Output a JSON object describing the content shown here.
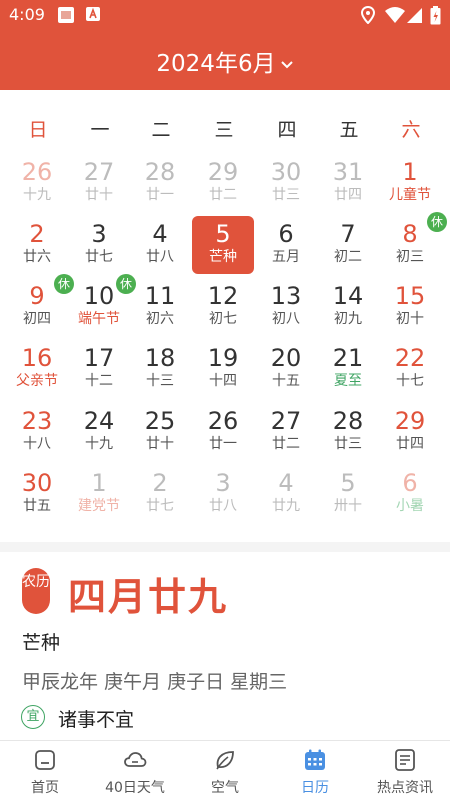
{
  "status_bar": {
    "time": "4:09"
  },
  "header": {
    "month_title": "2024年6月"
  },
  "weekdays": [
    "日",
    "一",
    "二",
    "三",
    "四",
    "五",
    "六"
  ],
  "calendar": {
    "days": [
      {
        "day": "26",
        "sub": "十九",
        "other": true
      },
      {
        "day": "27",
        "sub": "廿十",
        "other": true
      },
      {
        "day": "28",
        "sub": "廿一",
        "other": true
      },
      {
        "day": "29",
        "sub": "廿二",
        "other": true
      },
      {
        "day": "30",
        "sub": "廿三",
        "other": true
      },
      {
        "day": "31",
        "sub": "廿四",
        "other": true
      },
      {
        "day": "1",
        "sub": "儿童节",
        "sub_type": "festival"
      },
      {
        "day": "2",
        "sub": "廿六"
      },
      {
        "day": "3",
        "sub": "廿七"
      },
      {
        "day": "4",
        "sub": "廿八"
      },
      {
        "day": "5",
        "sub": "芒种",
        "today": true
      },
      {
        "day": "6",
        "sub": "五月"
      },
      {
        "day": "7",
        "sub": "初二"
      },
      {
        "day": "8",
        "sub": "初三",
        "badge": "休"
      },
      {
        "day": "9",
        "sub": "初四",
        "badge": "休"
      },
      {
        "day": "10",
        "sub": "端午节",
        "sub_type": "festival",
        "badge": "休"
      },
      {
        "day": "11",
        "sub": "初六"
      },
      {
        "day": "12",
        "sub": "初七"
      },
      {
        "day": "13",
        "sub": "初八"
      },
      {
        "day": "14",
        "sub": "初九"
      },
      {
        "day": "15",
        "sub": "初十"
      },
      {
        "day": "16",
        "sub": "父亲节",
        "sub_type": "festival"
      },
      {
        "day": "17",
        "sub": "十二"
      },
      {
        "day": "18",
        "sub": "十三"
      },
      {
        "day": "19",
        "sub": "十四"
      },
      {
        "day": "20",
        "sub": "十五"
      },
      {
        "day": "21",
        "sub": "夏至",
        "sub_type": "term"
      },
      {
        "day": "22",
        "sub": "十七"
      },
      {
        "day": "23",
        "sub": "十八"
      },
      {
        "day": "24",
        "sub": "十九"
      },
      {
        "day": "25",
        "sub": "廿十"
      },
      {
        "day": "26",
        "sub": "廿一"
      },
      {
        "day": "27",
        "sub": "廿二"
      },
      {
        "day": "28",
        "sub": "廿三"
      },
      {
        "day": "29",
        "sub": "廿四"
      },
      {
        "day": "30",
        "sub": "廿五"
      },
      {
        "day": "1",
        "sub": "建党节",
        "sub_type": "festival",
        "other": true
      },
      {
        "day": "2",
        "sub": "廿七",
        "other": true
      },
      {
        "day": "3",
        "sub": "廿八",
        "other": true
      },
      {
        "day": "4",
        "sub": "廿九",
        "other": true
      },
      {
        "day": "5",
        "sub": "卅十",
        "other": true
      },
      {
        "day": "6",
        "sub": "小暑",
        "sub_type": "term",
        "other": true
      }
    ]
  },
  "info": {
    "lunar_badge": "农历",
    "lunar_date": "四月廿九",
    "solar_term": "芒种",
    "ganzhi": "甲辰龙年 庚午月 庚子日 星期三",
    "yi_badge": "宜",
    "yi_text": "诸事不宜"
  },
  "nav": [
    {
      "label": "首页",
      "icon": "home-icon"
    },
    {
      "label": "40日天气",
      "icon": "cloud-icon"
    },
    {
      "label": "空气",
      "icon": "leaf-icon"
    },
    {
      "label": "日历",
      "icon": "calendar-icon",
      "active": true
    },
    {
      "label": "热点资讯",
      "icon": "news-icon"
    }
  ],
  "colors": {
    "primary": "#e0533b",
    "term_green": "#3fa463",
    "rest_badge": "#4caf50",
    "nav_active": "#4a90e2"
  }
}
